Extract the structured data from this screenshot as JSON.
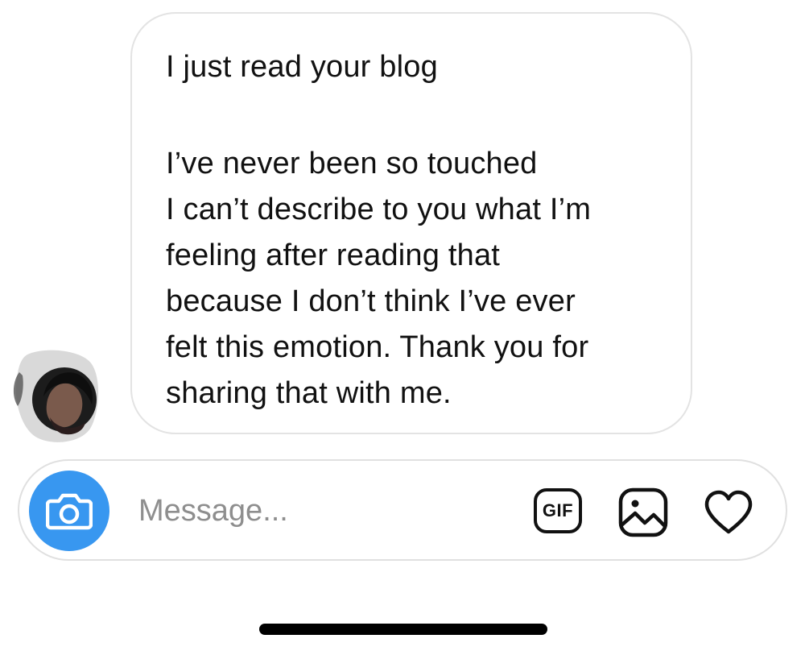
{
  "message": {
    "lines": [
      "I just read your blog",
      "I’ve never been so touched",
      "I can’t describe to you what I’m",
      "feeling after reading that",
      "because I don’t think I’ve ever",
      "felt this emotion. Thank you for",
      "sharing that with me."
    ]
  },
  "composer": {
    "placeholder": "Message...",
    "gif_label": "GIF"
  },
  "icons": {
    "camera": "camera-icon",
    "gif": "gif-icon",
    "gallery": "image-icon",
    "like": "heart-icon"
  },
  "colors": {
    "accent": "#3897f0",
    "bubble_border": "#e3e3e3",
    "placeholder_text": "#8e8e8e"
  }
}
